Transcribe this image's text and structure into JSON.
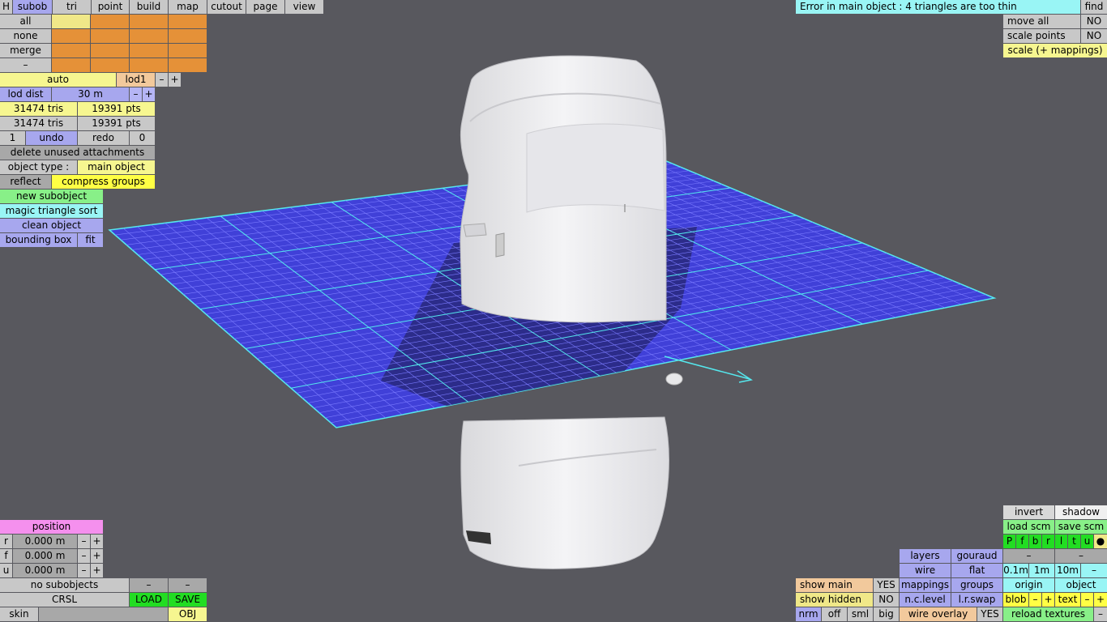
{
  "top_tabs": [
    "H",
    "subob",
    "tri",
    "point",
    "build",
    "map",
    "cutout",
    "page",
    "view"
  ],
  "subob_ops": {
    "all": "all",
    "none": "none",
    "merge": "merge",
    "minus": "–"
  },
  "lod": {
    "auto": "auto",
    "lod1": "lod1",
    "minus": "–",
    "plus": "+",
    "dist_label": "lod dist",
    "dist_value": "30 m",
    "dist_minus": "–",
    "dist_plus": "+"
  },
  "counts": {
    "tris1": "31474 tris",
    "pts1": "19391 pts",
    "tris2": "31474 tris",
    "pts2": "19391 pts"
  },
  "history": {
    "num": "1",
    "undo": "undo",
    "redo": "redo",
    "zero": "0"
  },
  "actions": {
    "delete_unused": "delete unused attachments",
    "object_type_label": "object type :",
    "object_type_value": "main object",
    "reflect": "reflect",
    "compress_groups": "compress groups",
    "new_subobject": "new subobject",
    "magic_sort": "magic triangle sort",
    "clean_object": "clean object",
    "bounding_box": "bounding box",
    "fit": "fit"
  },
  "status": {
    "error": "Error in main object : 4 triangles are too thin",
    "find": "find"
  },
  "right_top": {
    "move_all": "move all",
    "move_all_val": "NO",
    "scale_points": "scale points",
    "scale_points_val": "NO",
    "scale_mappings": "scale (+ mappings)"
  },
  "position": {
    "title": "position",
    "rows": [
      {
        "axis": "r",
        "value": "0.000 m",
        "minus": "–",
        "plus": "+"
      },
      {
        "axis": "f",
        "value": "0.000 m",
        "minus": "–",
        "plus": "+"
      },
      {
        "axis": "u",
        "value": "0.000 m",
        "minus": "–",
        "plus": "+"
      }
    ]
  },
  "bottom_left": {
    "no_subobjects": "no subobjects",
    "dash1": "–",
    "dash2": "–",
    "crsl": "CRSL",
    "load": "LOAD",
    "save": "SAVE",
    "skin": "skin",
    "obj": "OBJ"
  },
  "render": {
    "invert": "invert",
    "shadow": "shadow",
    "load_scm": "load scm",
    "save_scm": "save scm",
    "views": [
      "P",
      "f",
      "b",
      "r",
      "l",
      "t",
      "u",
      "●"
    ],
    "layers": "layers",
    "gouraud": "gouraud",
    "dash_a": "–",
    "dash_b": "–",
    "wire": "wire",
    "flat": "flat",
    "s01": "0.1m",
    "s1": "1m",
    "s10": "10m",
    "s_minus": "–",
    "mappings": "mappings",
    "groups": "groups",
    "origin": "origin",
    "object": "object",
    "show_main": "show main",
    "show_main_val": "YES",
    "nc_level": "n.c.level",
    "lr_swap": "l.r.swap",
    "blob": "blob",
    "blob_minus": "–",
    "blob_plus": "+",
    "text": "text",
    "text_minus": "–",
    "text_plus": "+",
    "show_hidden": "show hidden",
    "show_hidden_val": "NO",
    "nrm": "nrm",
    "off": "off",
    "sml": "sml",
    "big": "big",
    "wire_overlay": "wire overlay",
    "wire_overlay_val": "YES",
    "reload_textures": "reload textures",
    "reload_minus": "–"
  },
  "colors": {
    "background": "#58585e",
    "grid": "#4545dd",
    "grid_line": "#55e8ee",
    "model": "#eeeef0"
  }
}
